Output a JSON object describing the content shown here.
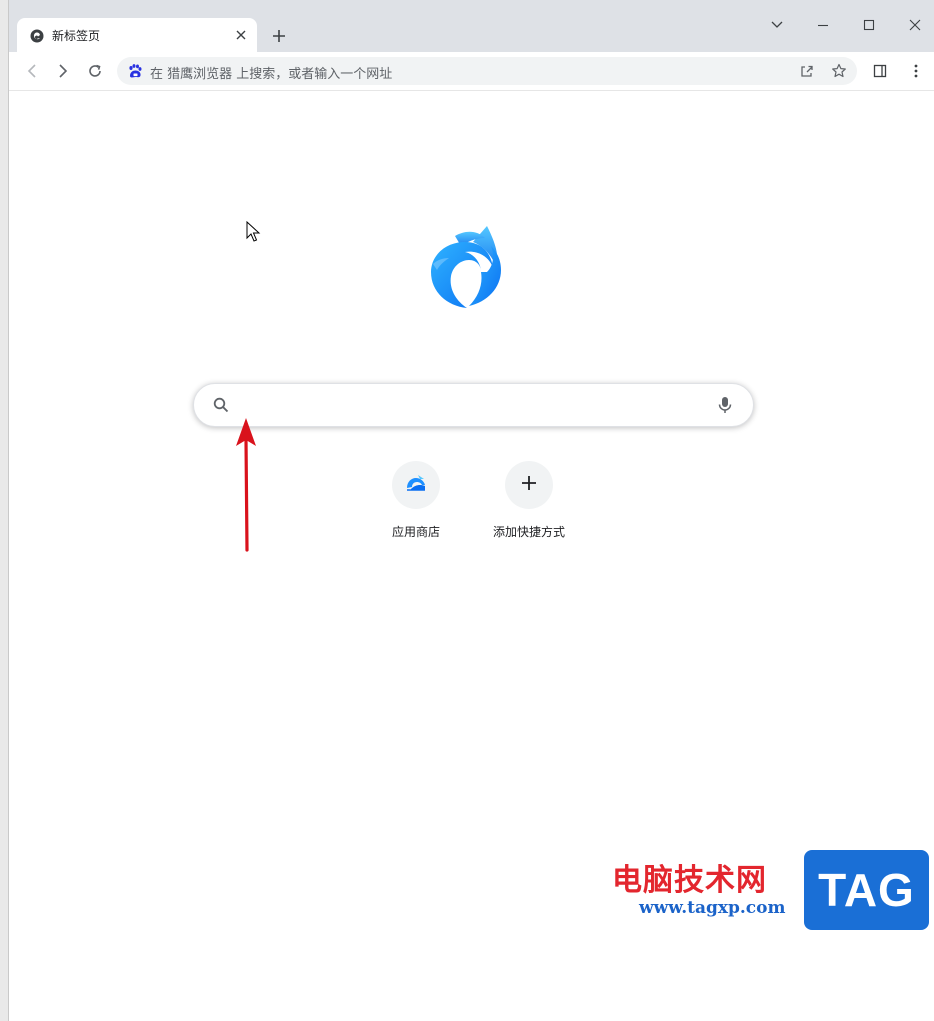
{
  "tab": {
    "title": "新标签页"
  },
  "omnibox": {
    "placeholder": "在 猎鹰浏览器 上搜索，或者输入一个网址"
  },
  "ntp": {
    "search_placeholder": ""
  },
  "shortcuts": [
    {
      "label": "应用商店",
      "icon": "app-store-icon"
    },
    {
      "label": "添加快捷方式",
      "icon": "plus-icon"
    }
  ],
  "watermark": {
    "site_name": "电脑技术网",
    "url": "www.tagxp.com",
    "badge": "TAG"
  },
  "colors": {
    "accent": "#1a73e8",
    "logo_blue": "#1e90ff",
    "annotation_red": "#d9121c"
  }
}
